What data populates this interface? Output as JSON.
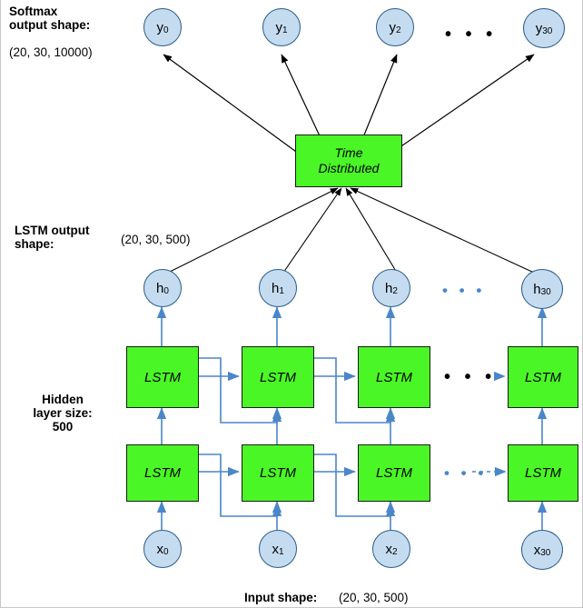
{
  "diagram": {
    "title_labels": {
      "softmax": "Softmax\noutput shape:",
      "softmax_shape": "(20, 30, 10000)",
      "lstm_output": "LSTM output\nshape:",
      "lstm_output_shape": "(20, 30, 500)",
      "hidden": "Hidden\nlayer size:\n500",
      "input_label": "Input shape:",
      "input_shape": "(20, 30, 500)"
    },
    "outputs": [
      {
        "label": "y",
        "sub": "0"
      },
      {
        "label": "y",
        "sub": "1"
      },
      {
        "label": "y",
        "sub": "2"
      },
      {
        "label": "y",
        "sub": "30"
      }
    ],
    "hidden_states": [
      {
        "label": "h",
        "sub": "0"
      },
      {
        "label": "h",
        "sub": "1"
      },
      {
        "label": "h",
        "sub": "2"
      },
      {
        "label": "h",
        "sub": "30"
      }
    ],
    "inputs": [
      {
        "label": "x",
        "sub": "0"
      },
      {
        "label": "x",
        "sub": "1"
      },
      {
        "label": "x",
        "sub": "2"
      },
      {
        "label": "x",
        "sub": "30"
      }
    ],
    "time_distributed": {
      "line1": "Time",
      "line2": "Distributed"
    },
    "lstm_cell_label": "LSTM",
    "ellipsis": "•  •  •",
    "colors": {
      "cell_fill": "#4af626",
      "cell_stroke": "#111111",
      "node_fill": "#c5dcf0",
      "node_stroke": "#2b5c8a",
      "arrow_blue": "#4a86c8",
      "arrow_black": "#000000",
      "border": "#c8c8c8"
    }
  }
}
